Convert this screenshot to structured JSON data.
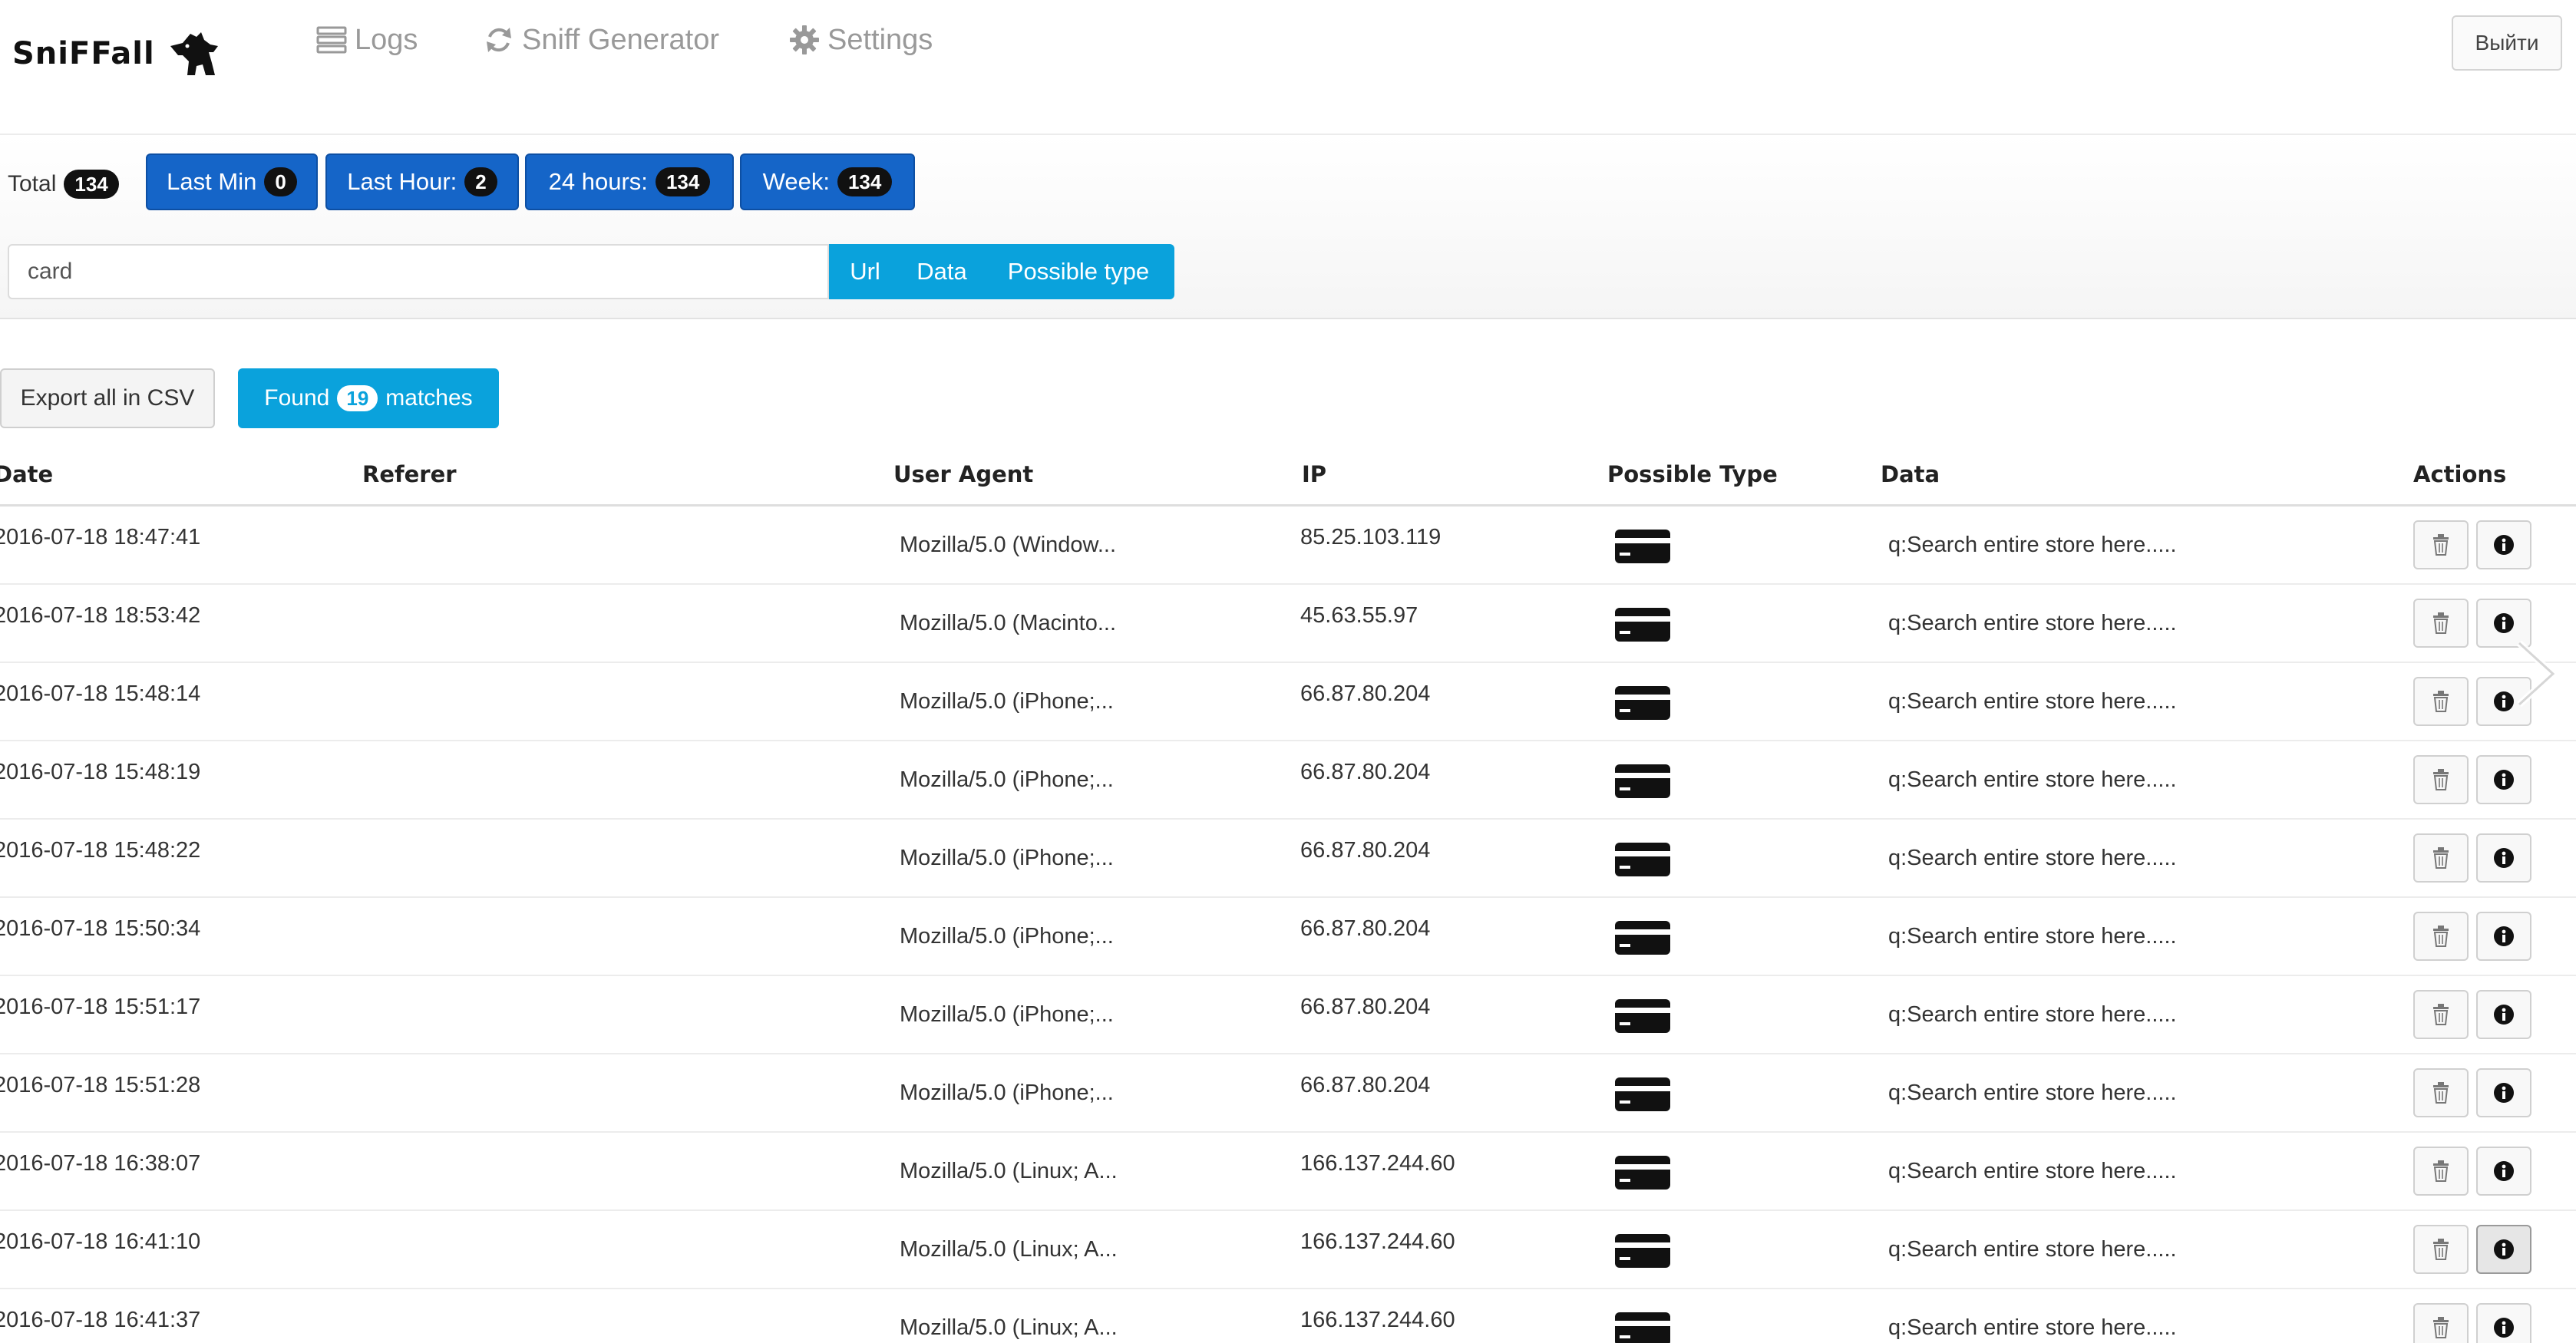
{
  "brand": {
    "name": "SniFFall"
  },
  "nav": {
    "logs": "Logs",
    "generator": "Sniff Generator",
    "settings": "Settings"
  },
  "header": {
    "logout_label": "Выйти"
  },
  "stats": {
    "total_label": "Total",
    "total": "134",
    "last_min_label": "Last Min",
    "last_min": "0",
    "last_hour_label": "Last Hour:",
    "last_hour": "2",
    "hours24_label": "24 hours:",
    "hours24": "134",
    "week_label": "Week:",
    "week": "134"
  },
  "search": {
    "value": "card",
    "filters": [
      "Url",
      "Data",
      "Possible type"
    ]
  },
  "actions": {
    "export_label": "Export all in CSV",
    "found_prefix": "Found",
    "found_count": "19",
    "found_suffix": "matches"
  },
  "table": {
    "headers": {
      "date": "Date",
      "referer": "Referer",
      "user_agent": "User Agent",
      "ip": "IP",
      "possible_type": "Possible Type",
      "data": "Data",
      "actions": "Actions"
    },
    "rows": [
      {
        "date": "2016-07-18 18:47:41",
        "referer": "",
        "user_agent": "Mozilla/5.0 (Window...",
        "ip": "85.25.103.119",
        "type_icon": "credit-card-icon",
        "data": "q:Search entire store here....."
      },
      {
        "date": "2016-07-18 18:53:42",
        "referer": "",
        "user_agent": "Mozilla/5.0 (Macinto...",
        "ip": "45.63.55.97",
        "type_icon": "credit-card-icon",
        "data": "q:Search entire store here....."
      },
      {
        "date": "2016-07-18 15:48:14",
        "referer": "",
        "user_agent": "Mozilla/5.0 (iPhone;...",
        "ip": "66.87.80.204",
        "type_icon": "credit-card-icon",
        "data": "q:Search entire store here....."
      },
      {
        "date": "2016-07-18 15:48:19",
        "referer": "",
        "user_agent": "Mozilla/5.0 (iPhone;...",
        "ip": "66.87.80.204",
        "type_icon": "credit-card-icon",
        "data": "q:Search entire store here....."
      },
      {
        "date": "2016-07-18 15:48:22",
        "referer": "",
        "user_agent": "Mozilla/5.0 (iPhone;...",
        "ip": "66.87.80.204",
        "type_icon": "credit-card-icon",
        "data": "q:Search entire store here....."
      },
      {
        "date": "2016-07-18 15:50:34",
        "referer": "",
        "user_agent": "Mozilla/5.0 (iPhone;...",
        "ip": "66.87.80.204",
        "type_icon": "credit-card-icon",
        "data": "q:Search entire store here....."
      },
      {
        "date": "2016-07-18 15:51:17",
        "referer": "",
        "user_agent": "Mozilla/5.0 (iPhone;...",
        "ip": "66.87.80.204",
        "type_icon": "credit-card-icon",
        "data": "q:Search entire store here....."
      },
      {
        "date": "2016-07-18 15:51:28",
        "referer": "",
        "user_agent": "Mozilla/5.0 (iPhone;...",
        "ip": "66.87.80.204",
        "type_icon": "credit-card-icon",
        "data": "q:Search entire store here....."
      },
      {
        "date": "2016-07-18 16:38:07",
        "referer": "",
        "user_agent": "Mozilla/5.0 (Linux; A...",
        "ip": "166.137.244.60",
        "type_icon": "credit-card-icon",
        "data": "q:Search entire store here....."
      },
      {
        "date": "2016-07-18 16:41:10",
        "referer": "",
        "user_agent": "Mozilla/5.0 (Linux; A...",
        "ip": "166.137.244.60",
        "type_icon": "credit-card-icon",
        "data": "q:Search entire store here....."
      },
      {
        "date": "2016-07-18 16:41:37",
        "referer": "",
        "user_agent": "Mozilla/5.0 (Linux; A...",
        "ip": "166.137.244.60",
        "type_icon": "credit-card-icon",
        "data": "q:Search entire store here....."
      }
    ]
  },
  "icons": {
    "nav_logs": "list-icon",
    "nav_generator": "refresh-icon",
    "nav_settings": "gear-icon",
    "delete": "trash-icon",
    "info": "info-icon",
    "next": "chevron-right-icon"
  },
  "colors": {
    "primary": "#1565c8",
    "info": "#0aa2dc",
    "badge": "#111111",
    "nav": "#999999"
  }
}
